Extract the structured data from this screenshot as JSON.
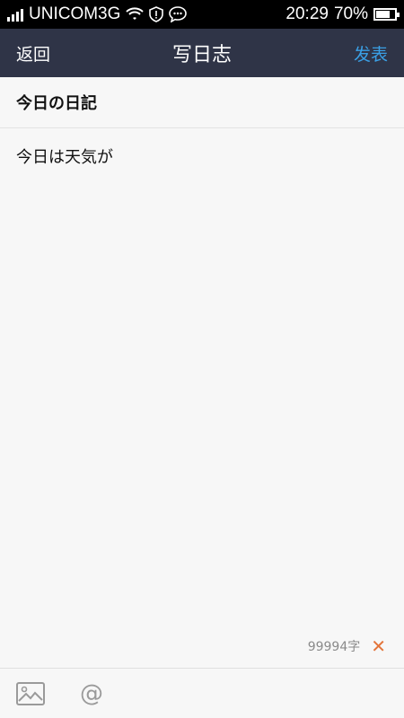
{
  "statusbar": {
    "carrier": "UNICOM3G",
    "time": "20:29",
    "battery_text": "70%",
    "battery_level": 0.7
  },
  "nav": {
    "back": "返回",
    "title": "写日志",
    "post": "发表"
  },
  "editor": {
    "title_value": "今日の日記",
    "body_value": "今日は天気が",
    "remaining_count": "99994字",
    "clear_symbol": "✕"
  },
  "toolbar": {
    "image_icon": "image-icon",
    "mention_symbol": "@"
  },
  "colors": {
    "nav_bg": "#2f3447",
    "accent": "#3aa0e6",
    "clear": "#e3743a"
  }
}
